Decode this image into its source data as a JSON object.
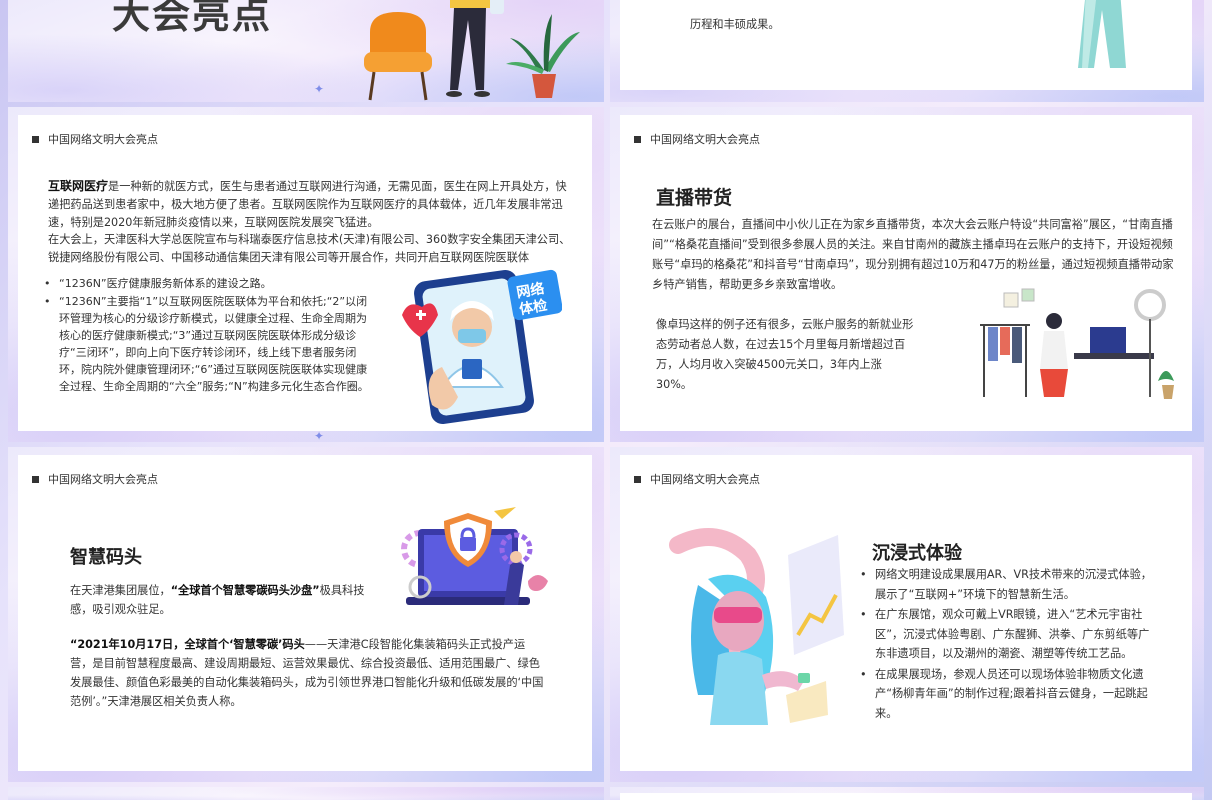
{
  "slide1": {
    "title": "大会亮点"
  },
  "slide2": {
    "text": "历程和丰硕成果。"
  },
  "common": {
    "card_label": "中国网络文明大会亮点"
  },
  "slide3": {
    "para_head": "互联网医疗",
    "para_rest": "是一种新的就医方式，医生与患者通过互联网进行沟通，无需见面，医生在网上开具处方，快递把药品送到患者家中，极大地方便了患者。互联网医院作为互联网医疗的具体载体，近几年发展非常迅速，特别是2020年新冠肺炎疫情以来，互联网医院发展突飞猛进。",
    "para2": "在大会上，天津医科大学总医院宣布与科瑞泰医疗信息技术(天津)有限公司、360数字安全集团天津公司、锐捷网络股份有限公司、中国移动通信集团天津有限公司等开展合作，共同开启互联网医院医联体",
    "b1": "“1236N”医疗健康服务新体系的建设之路。",
    "b2_pre": "“1236N”主要指“1”以互联网医院医联体为平台和依托;“2”以闭环管理为核心的分级诊疗新模式，以健康全过程、生命全周期为核心的医疗健康新模式;“3”通过互联网医院医联体形成分级诊疗“三闭环”，即向上向下医疗转诊闭环，线上线下患者服务闭环，院内院外健康管理闭环;“6”通过互联网医院医联体实现健康全过程、生命全周期的“六全”服务;“N”构建多元化生态合作圈。",
    "badge": "网络体检"
  },
  "slide4": {
    "title": "直播带货",
    "para": "在云账户的展台，直播间中小伙儿正在为家乡直播带货，本次大会云账户特设“共同富裕”展区，“甘南直播间”“格桑花直播间”受到很多参展人员的关注。来自甘南州的藏族主播卓玛在云账户的支持下，开设短视频账号“卓玛的格桑花”和抖音号“甘南卓玛”，现分别拥有超过10万和47万的粉丝量，通过短视频直播带动家乡特产销售，帮助更多乡亲致富增收。",
    "para2": "像卓玛这样的例子还有很多，云账户服务的新就业形态劳动者总人数，在过去15个月里每月新增超过百万，人均月收入突破4500元关口，3年内上涨30%。"
  },
  "slide5": {
    "title": "智慧码头",
    "p1_pre": "在天津港集团展位，",
    "p1_bold": "“全球首个智慧零碳码头沙盘”",
    "p1_post": "极具科技感，吸引观众驻足。",
    "p2_bold": "“2021年10月17日，全球首个‘智慧零碳’码头",
    "p2_rest": "——天津港C段智能化集装箱码头正式投产运营，是目前智慧程度最高、建设周期最短、运营效果最优、综合投资最低、适用范围最广、绿色发展最佳、颜值色彩最美的自动化集装箱码头，成为引领世界港口智能化升级和低碳发展的‘中国范例’。”天津港展区相关负责人称。"
  },
  "slide6": {
    "title": "沉浸式体验",
    "bullets": [
      "网络文明建设成果展用AR、VR技术带来的沉浸式体验，展示了“互联网+”环境下的智慧新生活。",
      "在广东展馆，观众可戴上VR眼镜，进入“艺术元宇宙社区”，沉浸式体验粤剧、广东醒狮、洪拳、广东剪纸等广东非遗项目，以及潮州的潮瓷、潮塑等传统工艺品。",
      "在成果展现场，参观人员还可以现场体验非物质文化遗产“杨柳青年画”的制作过程;跟着抖音云健身，一起跳起来。"
    ]
  }
}
